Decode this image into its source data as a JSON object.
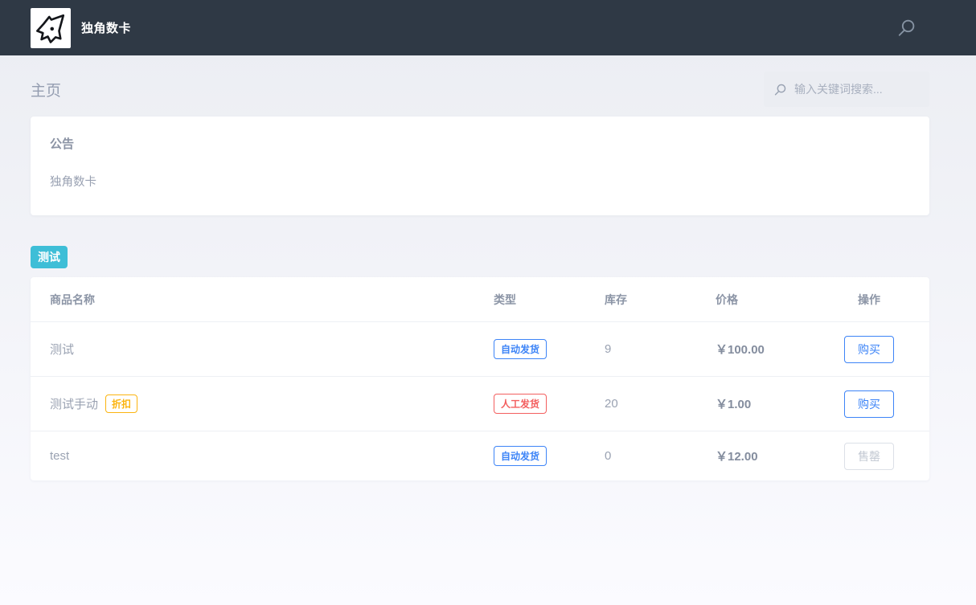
{
  "header": {
    "brand": "独角数卡"
  },
  "page": {
    "title": "主页",
    "search_placeholder": "输入关键词搜索..."
  },
  "announcement": {
    "title": "公告",
    "body": "独角数卡"
  },
  "group": {
    "label": "测试"
  },
  "table": {
    "headers": [
      "商品名称",
      "类型",
      "库存",
      "价格",
      "操作"
    ],
    "rows": [
      {
        "name": "测试",
        "type": "自动发货",
        "stock": "9",
        "price": "￥100.00",
        "action": "购买"
      },
      {
        "name": "测试手动",
        "tag": "折扣",
        "type": "人工发货",
        "stock": "20",
        "price": "￥1.00",
        "action": "购买"
      },
      {
        "name": "test",
        "type": "自动发货",
        "stock": "0",
        "price": "￥12.00",
        "action": "售罄"
      }
    ]
  },
  "icons": {
    "logo": "unicorn-icon",
    "navbar_search": "search-icon",
    "input_search": "search-icon"
  },
  "colors": {
    "header_bg": "#2f3945",
    "accent_blue": "#3d84f7",
    "badge_teal": "#3ebed7",
    "badge_red": "#f35f5f",
    "badge_yellow": "#fbb410"
  }
}
